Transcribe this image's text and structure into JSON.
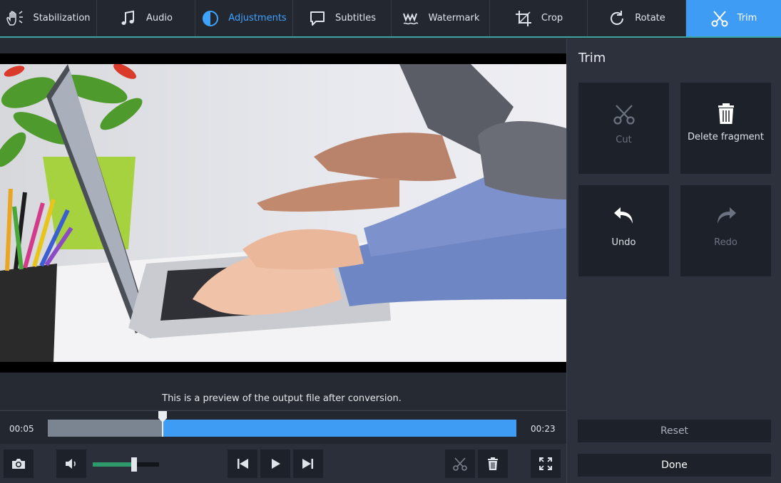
{
  "tabs": [
    {
      "label": "Stabilization",
      "icon": "hand-icon"
    },
    {
      "label": "Audio",
      "icon": "music-note-icon"
    },
    {
      "label": "Adjustments",
      "icon": "contrast-icon"
    },
    {
      "label": "Subtitles",
      "icon": "speech-bubble-icon"
    },
    {
      "label": "Watermark",
      "icon": "watermark-icon"
    },
    {
      "label": "Crop",
      "icon": "crop-icon"
    },
    {
      "label": "Rotate",
      "icon": "rotate-icon"
    },
    {
      "label": "Trim",
      "icon": "scissors-icon"
    }
  ],
  "colors": {
    "accent": "#3f9cf5",
    "adjust_active": "#3fa2ff",
    "volume": "#2e9a6b",
    "teal_line": "#3aa3a0"
  },
  "preview": {
    "note": "This is a preview of the output file after conversion."
  },
  "timeline": {
    "start": "00:05",
    "end": "00:23",
    "played_fraction": 0.245
  },
  "volume": {
    "level": 0.62
  },
  "panel": {
    "title": "Trim",
    "tools": [
      {
        "label": "Cut",
        "enabled": false,
        "icon": "scissors-icon"
      },
      {
        "label": "Delete fragment",
        "enabled": true,
        "icon": "trash-icon"
      },
      {
        "label": "Undo",
        "enabled": true,
        "icon": "undo-icon"
      },
      {
        "label": "Redo",
        "enabled": false,
        "icon": "redo-icon"
      }
    ],
    "reset_label": "Reset",
    "done_label": "Done"
  }
}
